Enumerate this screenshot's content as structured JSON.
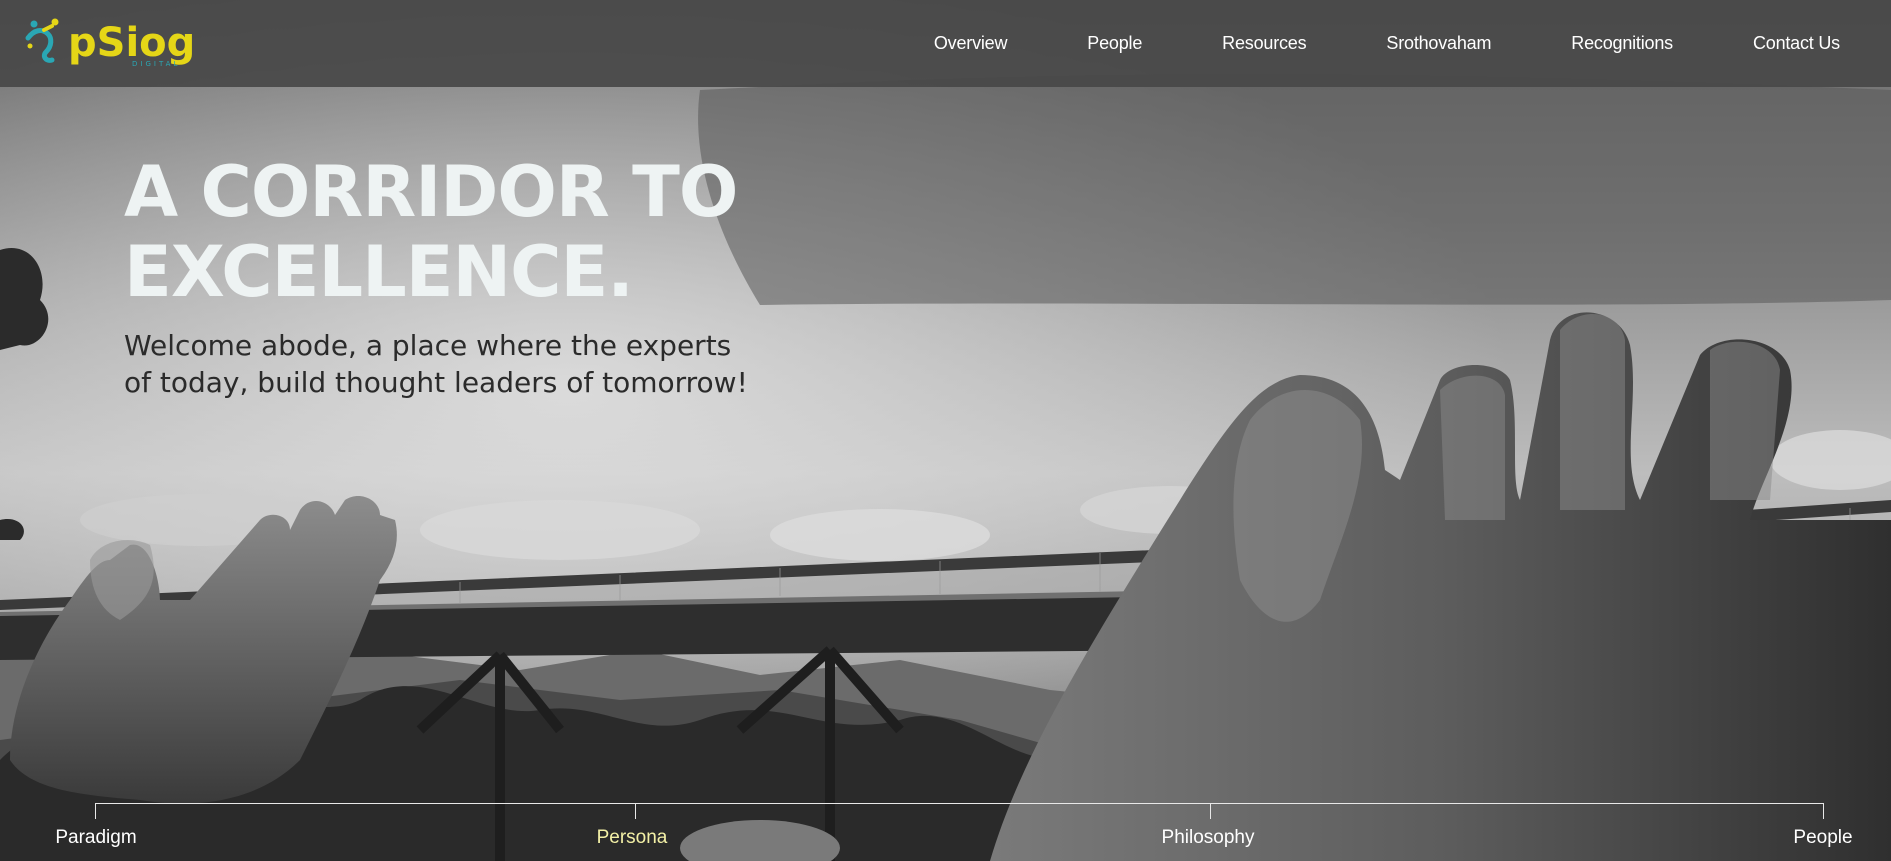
{
  "brand": {
    "logo_text": "pSiog",
    "logo_subtext": "DIGITAL",
    "primary_color": "#e5d617",
    "secondary_color": "#2aa7b4"
  },
  "nav": {
    "items": [
      {
        "label": "Overview"
      },
      {
        "label": "People"
      },
      {
        "label": "Resources"
      },
      {
        "label": "Srothovaham"
      },
      {
        "label": "Recognitions"
      },
      {
        "label": "Contact Us"
      }
    ]
  },
  "hero": {
    "title_line1": "A CORRIDOR TO",
    "title_line2": "EXCELLENCE.",
    "subtitle_line1": "Welcome abode, a place where the experts",
    "subtitle_line2": "of today, build thought leaders of tomorrow!",
    "image_icon": "golden-bridge-photo"
  },
  "timeline": {
    "items": [
      {
        "label": "Paradigm",
        "active": false
      },
      {
        "label": "Persona",
        "active": true
      },
      {
        "label": "Philosophy",
        "active": false
      },
      {
        "label": "People",
        "active": false
      }
    ],
    "active_color": "#f3f0a6"
  }
}
